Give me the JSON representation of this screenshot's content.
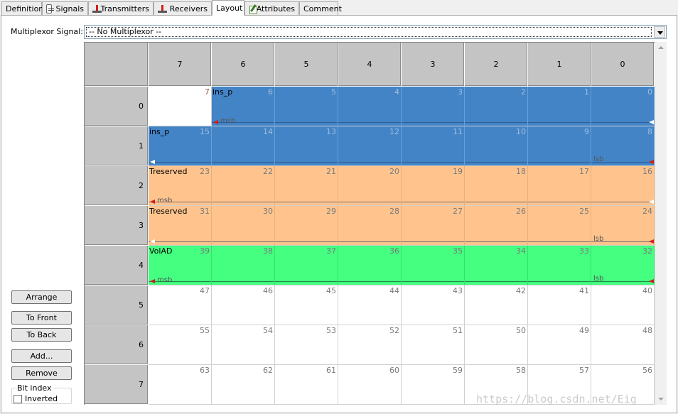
{
  "tabs": [
    {
      "label": "Definition",
      "icon": ""
    },
    {
      "label": "Signals",
      "icon": "signals-icon"
    },
    {
      "label": "Transmitters",
      "icon": "transmitter-icon"
    },
    {
      "label": "Receivers",
      "icon": "receiver-icon"
    },
    {
      "label": "Layout",
      "icon": "",
      "active": true
    },
    {
      "label": "Attributes",
      "icon": "attributes-icon"
    },
    {
      "label": "Comment",
      "icon": ""
    }
  ],
  "multiplexor": {
    "label": "Multiplexor Signal:",
    "value": "-- No Multiplexor --"
  },
  "grid": {
    "columns": [
      "7",
      "6",
      "5",
      "4",
      "3",
      "2",
      "1",
      "0"
    ],
    "rows": [
      {
        "label": "0",
        "bits": [
          "7",
          "6",
          "5",
          "4",
          "3",
          "2",
          "1",
          "0"
        ]
      },
      {
        "label": "1",
        "bits": [
          "15",
          "14",
          "13",
          "12",
          "11",
          "10",
          "9",
          "8"
        ]
      },
      {
        "label": "2",
        "bits": [
          "23",
          "22",
          "21",
          "20",
          "19",
          "18",
          "17",
          "16"
        ]
      },
      {
        "label": "3",
        "bits": [
          "31",
          "30",
          "29",
          "28",
          "27",
          "26",
          "25",
          "24"
        ]
      },
      {
        "label": "4",
        "bits": [
          "39",
          "38",
          "37",
          "36",
          "35",
          "34",
          "33",
          "32"
        ]
      },
      {
        "label": "5",
        "bits": [
          "47",
          "46",
          "45",
          "44",
          "43",
          "42",
          "41",
          "40"
        ]
      },
      {
        "label": "6",
        "bits": [
          "55",
          "54",
          "53",
          "52",
          "51",
          "50",
          "49",
          "48"
        ]
      },
      {
        "label": "7",
        "bits": [
          "63",
          "62",
          "61",
          "60",
          "59",
          "58",
          "57",
          "56"
        ]
      }
    ]
  },
  "signals": [
    {
      "name": "ins_p",
      "color": "#4384c6"
    },
    {
      "name": "Treserved",
      "color": "#ffc48e"
    },
    {
      "name": "VolAD",
      "color": "#44ff80"
    }
  ],
  "markers": {
    "msb": "msb",
    "lsb": "lsb"
  },
  "buttons": {
    "arrange": "Arrange",
    "to_front": "To Front",
    "to_back": "To Back",
    "add": "Add...",
    "remove": "Remove"
  },
  "bit_index": {
    "title": "Bit index",
    "inverted_label": "Inverted",
    "inverted_checked": false
  },
  "watermark": "https://blog.csdn.net/Eig"
}
